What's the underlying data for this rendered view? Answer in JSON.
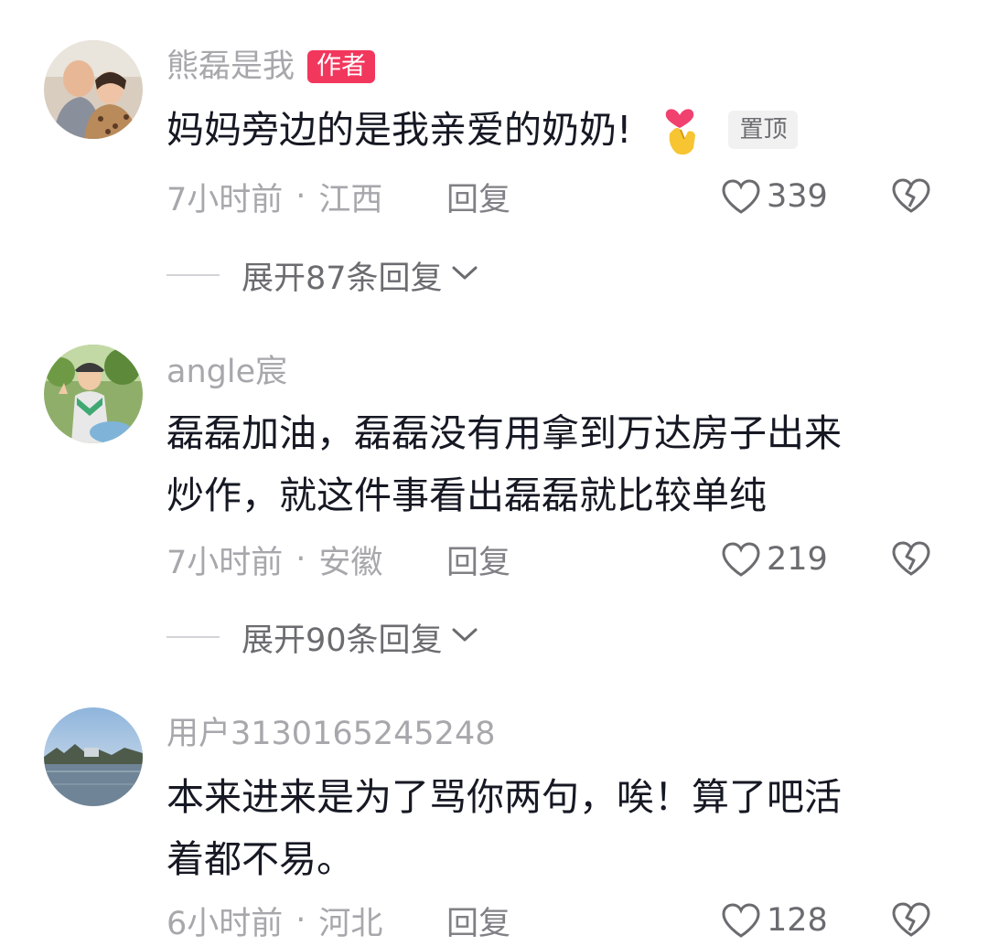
{
  "comments": [
    {
      "username": "熊磊是我",
      "badge": "作者",
      "content": "妈妈旁边的是我亲爱的奶奶!",
      "emoji": "heart-hands-emoji",
      "pin": "置顶",
      "time": "7小时前",
      "dot": "·",
      "location": "江西",
      "reply": "回复",
      "likes": "339",
      "expand": "展开87条回复"
    },
    {
      "username": "angle宸",
      "content_line1": "磊磊加油，磊磊没有用拿到万达房子出来",
      "content_line2": "炒作，就这件事看出磊磊就比较单纯",
      "time": "7小时前",
      "dot": "·",
      "location": "安徽",
      "reply": "回复",
      "likes": "219",
      "expand": "展开90条回复"
    },
    {
      "username": "用户3130165245248",
      "content_line1": "本来进来是为了骂你两句，唉！算了吧活",
      "content_line2": "着都不易。",
      "time": "6小时前",
      "dot": "·",
      "location": "河北",
      "reply": "回复",
      "likes": "128"
    }
  ],
  "icons": {
    "like": "heart-outline-icon",
    "dislike": "broken-heart-icon",
    "expand": "chevron-down-icon"
  },
  "colors": {
    "author_badge": "#f2375d",
    "text_primary": "#161823",
    "text_secondary": "#a7a7ac"
  }
}
